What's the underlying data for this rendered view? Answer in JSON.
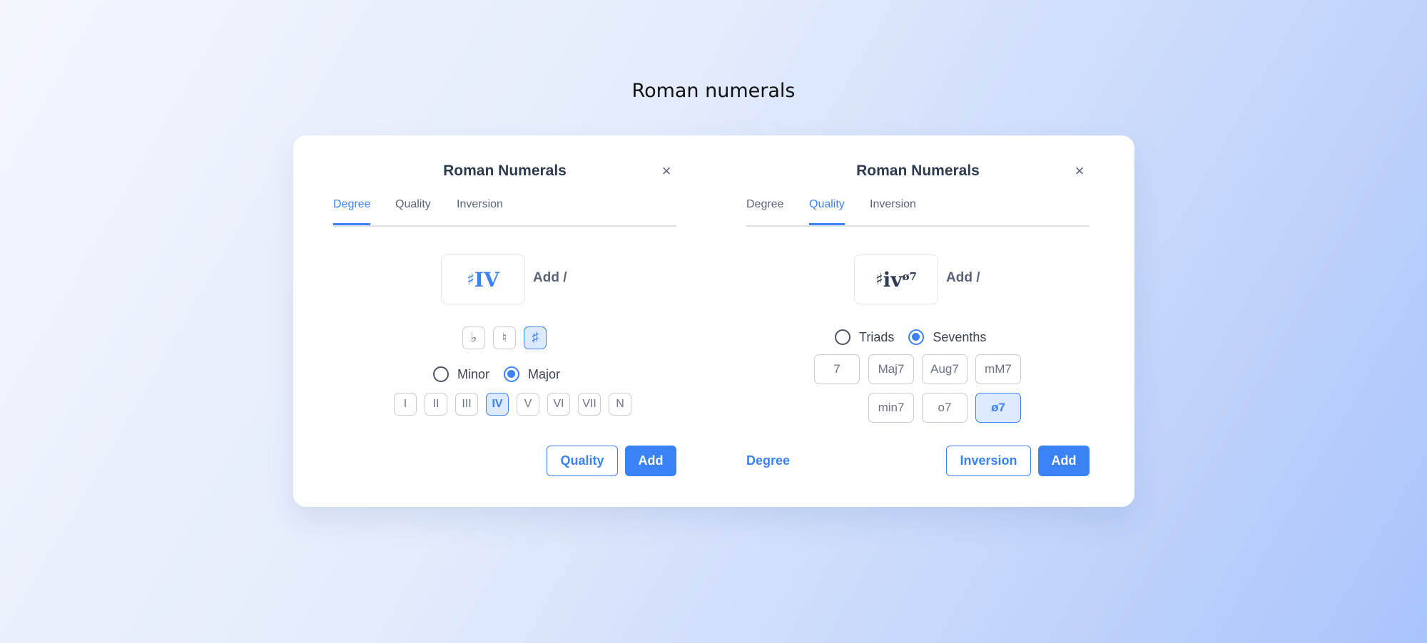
{
  "page": {
    "title": "Roman numerals"
  },
  "colors": {
    "accent": "#3b82f6",
    "text": "#2e3a4f",
    "muted": "#6b7385"
  },
  "left_panel": {
    "title": "Roman Numerals",
    "close_icon": "×",
    "tabs": [
      {
        "label": "Degree",
        "active": true
      },
      {
        "label": "Quality",
        "active": false
      },
      {
        "label": "Inversion",
        "active": false
      }
    ],
    "preview": {
      "accidental": "♯",
      "numeral": "IV",
      "add_label": "Add /"
    },
    "accidentals": [
      {
        "label": "♭",
        "active": false
      },
      {
        "label": "♮",
        "active": false
      },
      {
        "label": "♯",
        "active": true
      }
    ],
    "mode_options": [
      {
        "label": "Minor",
        "checked": false
      },
      {
        "label": "Major",
        "checked": true
      }
    ],
    "degrees": [
      {
        "label": "I",
        "active": false
      },
      {
        "label": "II",
        "active": false
      },
      {
        "label": "III",
        "active": false
      },
      {
        "label": "IV",
        "active": true
      },
      {
        "label": "V",
        "active": false
      },
      {
        "label": "VI",
        "active": false
      },
      {
        "label": "VII",
        "active": false
      },
      {
        "label": "N",
        "active": false
      }
    ],
    "buttons": {
      "secondary": "Quality",
      "primary": "Add"
    }
  },
  "right_panel": {
    "title": "Roman Numerals",
    "close_icon": "×",
    "tabs": [
      {
        "label": "Degree",
        "active": false
      },
      {
        "label": "Quality",
        "active": true
      },
      {
        "label": "Inversion",
        "active": false
      }
    ],
    "preview": {
      "accidental": "♯",
      "numeral": "iv",
      "superscript": "ø7",
      "add_label": "Add /"
    },
    "chord_type_options": [
      {
        "label": "Triads",
        "checked": false
      },
      {
        "label": "Sevenths",
        "checked": true
      }
    ],
    "qualities_row1": [
      {
        "label": "7",
        "active": false
      },
      {
        "label": "Maj7",
        "active": false
      },
      {
        "label": "Aug7",
        "active": false
      },
      {
        "label": "mM7",
        "active": false
      }
    ],
    "qualities_row2": [
      {
        "label": "min7",
        "active": false
      },
      {
        "label": "o7",
        "active": false
      },
      {
        "label": "ø7",
        "active": true
      }
    ],
    "buttons": {
      "back": "Degree",
      "secondary": "Inversion",
      "primary": "Add"
    }
  }
}
